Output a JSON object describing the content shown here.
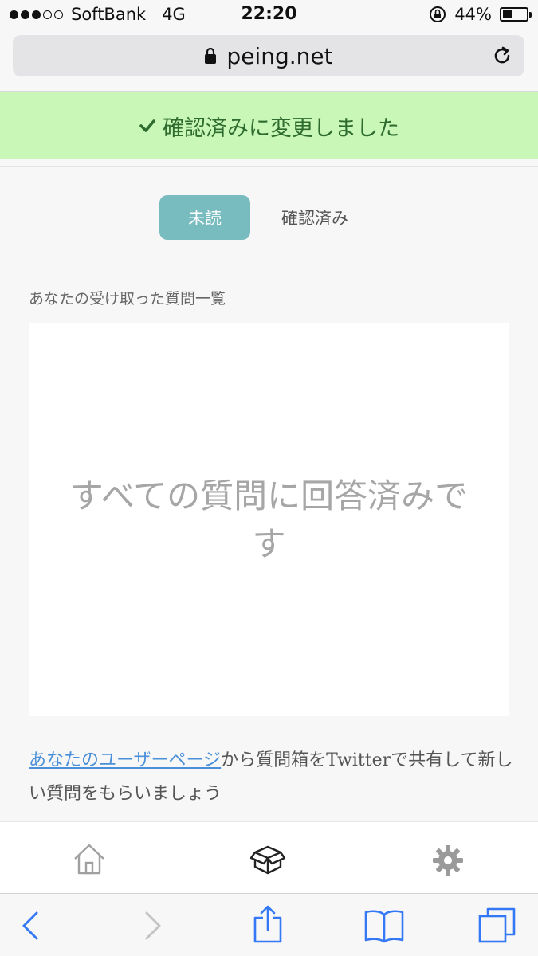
{
  "status_bar": {
    "carrier": "SoftBank",
    "network": "4G",
    "time": "22:20",
    "battery_percent": "44%",
    "battery_level": 0.44,
    "signal_bars_filled": 3,
    "signal_bars_total": 5
  },
  "browser": {
    "url": "peing.net",
    "icons": {
      "lock": "lock-icon",
      "reload": "reload-icon"
    }
  },
  "banner": {
    "message": "確認済みに変更しました",
    "color": "#c8f7b8",
    "text_color": "#2e6b2e",
    "icon": "check-icon"
  },
  "tabs": {
    "unread_label": "未読",
    "confirmed_label": "確認済み",
    "active_color": "#78bcbf"
  },
  "questions": {
    "section_title": "あなたの受け取った質問一覧",
    "empty_message": "すべての質問に回答済みです"
  },
  "share": {
    "link_text": "あなたのユーザーページ",
    "rest_text": "から質問箱をTwitterで共有して新しい質問をもらいましょう",
    "link_color": "#4a8fd9"
  },
  "app_nav": {
    "items": [
      "home-icon",
      "box-icon",
      "gear-icon"
    ]
  },
  "safari_toolbar": {
    "items": [
      "back-icon",
      "forward-icon",
      "share-icon",
      "bookmarks-icon",
      "tabs-icon"
    ],
    "accent": "#3478f6"
  }
}
